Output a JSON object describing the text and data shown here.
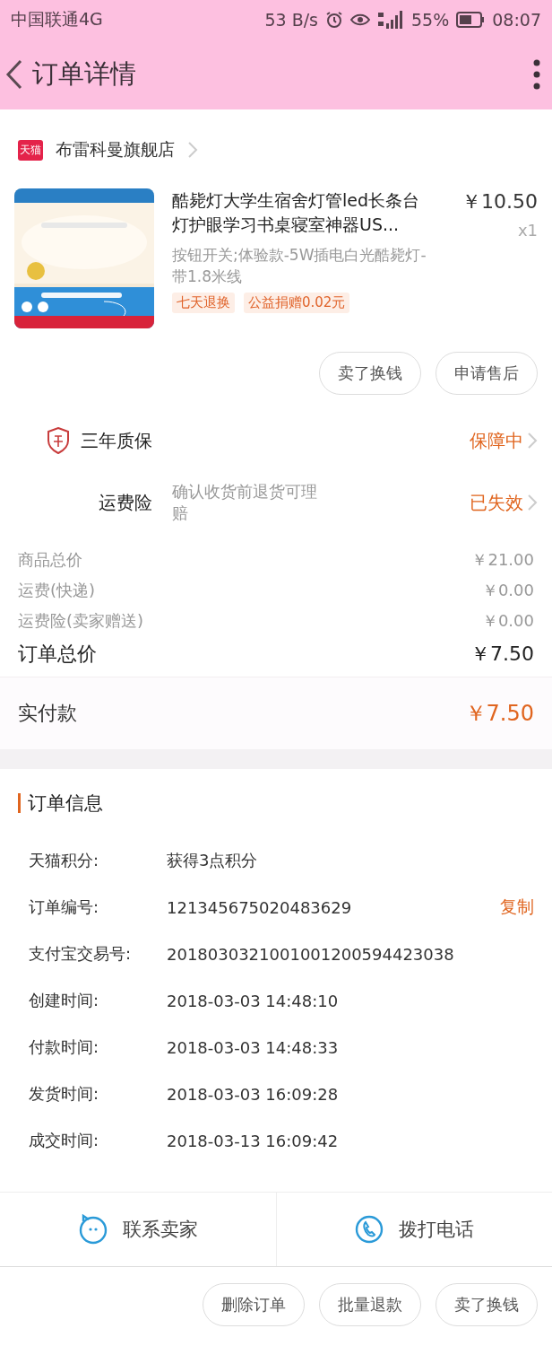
{
  "status_bar": {
    "carrier": "中国联通4G",
    "speed": "53 B/s",
    "battery": "55%",
    "time": "08:07"
  },
  "header": {
    "title": "订单详情"
  },
  "store": {
    "name": "布雷科曼旗舰店",
    "badge": "天猫"
  },
  "product": {
    "title": "酷毙灯大学生宿舍灯管led长条台灯护眼学习书桌寝室神器US...",
    "price": "￥10.50",
    "quantity": "x1",
    "spec": "按钮开关;体验款-5W插电白光酷毙灯-带1.8米线",
    "tags": [
      "七天退换",
      "公益捐赠0.02元"
    ]
  },
  "item_actions": [
    "卖了换钱",
    "申请售后"
  ],
  "services": [
    {
      "kind": "warranty",
      "label": "三年质保",
      "status": "保障中"
    },
    {
      "kind": "insurance",
      "label": "运费险",
      "note": "确认收货前退货可理赔",
      "status": "已失效"
    }
  ],
  "price_lines": [
    {
      "label": "商品总价",
      "value": "￥21.00",
      "emphasis": false
    },
    {
      "label": "运费(快递)",
      "value": "￥0.00",
      "emphasis": false
    },
    {
      "label": "运费险(卖家赠送)",
      "value": "￥0.00",
      "emphasis": false
    },
    {
      "label": "订单总价",
      "value": "￥7.50",
      "emphasis": true
    }
  ],
  "paid": {
    "label": "实付款",
    "value": "￥7.50"
  },
  "order_info": {
    "title": "订单信息",
    "rows": [
      {
        "label": "天猫积分:",
        "value": "获得3点积分"
      },
      {
        "label": "订单编号:",
        "value": "121345675020483629",
        "action": "复制"
      },
      {
        "label": "支付宝交易号:",
        "value": "2018030321001001200594423038"
      },
      {
        "label": "创建时间:",
        "value": "2018-03-03 14:48:10"
      },
      {
        "label": "付款时间:",
        "value": "2018-03-03 14:48:33"
      },
      {
        "label": "发货时间:",
        "value": "2018-03-03 16:09:28"
      },
      {
        "label": "成交时间:",
        "value": "2018-03-13 16:09:42"
      }
    ]
  },
  "contact_bar": [
    {
      "kind": "chat",
      "label": "联系卖家"
    },
    {
      "kind": "phone",
      "label": "拨打电话"
    }
  ],
  "bottom_actions": [
    "删除订单",
    "批量退款",
    "卖了换钱"
  ]
}
